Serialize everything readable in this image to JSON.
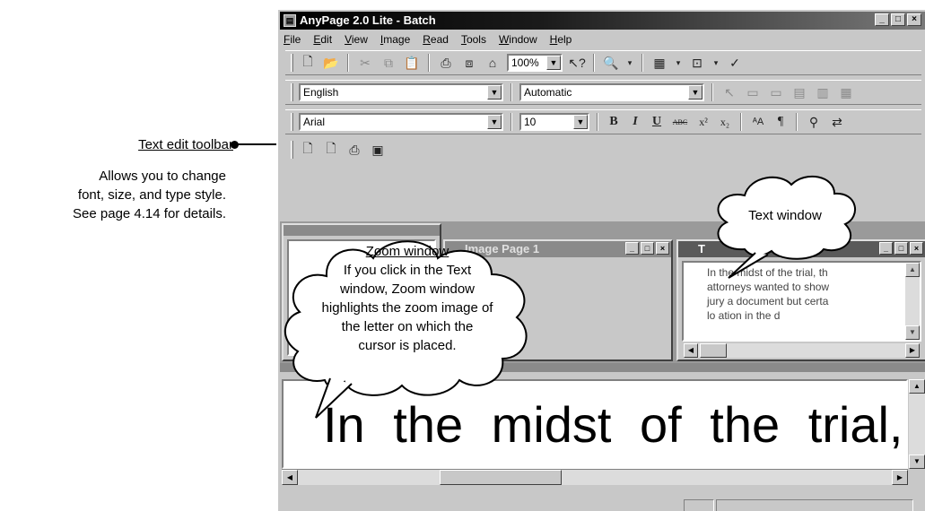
{
  "annotation": {
    "title": "Text edit toolbar",
    "lines": [
      "Allows you to change",
      "font, size, and type style.",
      "See page 4.14 for details."
    ]
  },
  "window": {
    "title": "AnyPage 2.0 Lite - Batch",
    "buttons": [
      "_",
      "□",
      "×"
    ]
  },
  "menu": [
    "File",
    "Edit",
    "View",
    "Image",
    "Read",
    "Tools",
    "Window",
    "Help"
  ],
  "toolbar1": {
    "zoom_value": "100%"
  },
  "toolbar2": {
    "language": "English",
    "mode": "Automatic"
  },
  "text_toolbar": {
    "font": "Arial",
    "size": "10",
    "bold": "B",
    "italic": "I",
    "underline": "U",
    "strike": "ABC",
    "superscript": "x²",
    "subscript": "x₂",
    "pilcrow": "¶"
  },
  "image_window": {
    "title": "Image Page 1"
  },
  "text_window": {
    "title": "T",
    "lines": [
      "In the midst of the trial, th",
      "attorneys wanted to show",
      "jury a document but certa",
      "lo     ation in the d"
    ]
  },
  "zoom": {
    "text": "In the midst of the trial,"
  },
  "callouts": {
    "text_window": "Text window",
    "zoom_title": "Zoom window",
    "zoom_lines": [
      "If you click in the Text",
      "window, Zoom window",
      "highlights the zoom image of",
      "the letter on which the",
      "cursor is placed."
    ]
  }
}
